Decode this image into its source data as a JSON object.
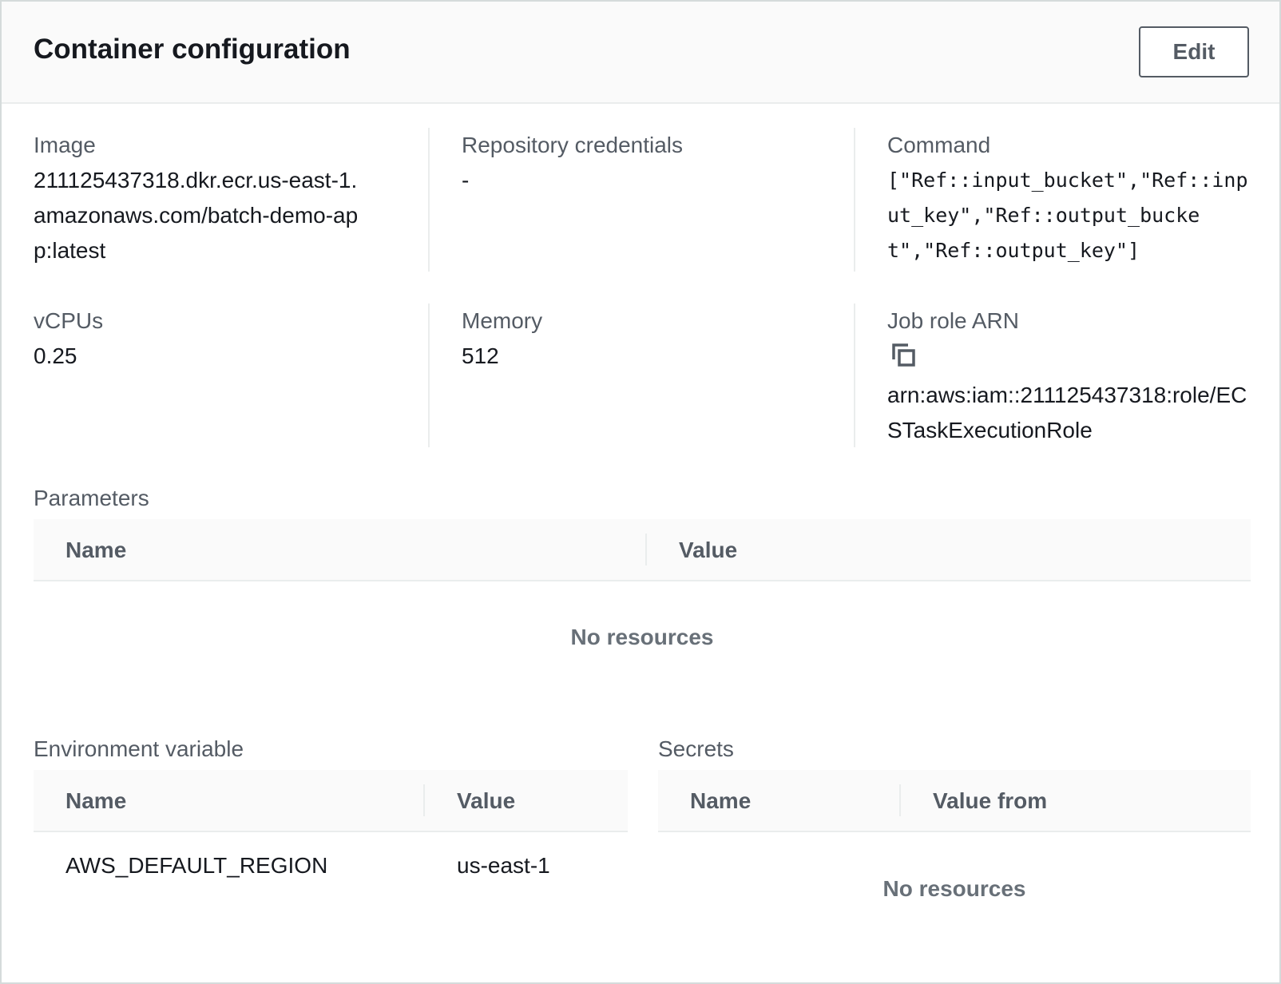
{
  "header": {
    "title": "Container configuration",
    "edit_label": "Edit"
  },
  "details": {
    "image": {
      "label": "Image",
      "value": "211125437318.dkr.ecr.us-east-1.amazonaws.com/batch-demo-app:latest"
    },
    "repo_credentials": {
      "label": "Repository credentials",
      "value": "-"
    },
    "command": {
      "label": "Command",
      "value": "[\"Ref::input_bucket\",\"Ref::input_key\",\"Ref::output_bucket\",\"Ref::output_key\"]"
    },
    "vcpus": {
      "label": "vCPUs",
      "value": "0.25"
    },
    "memory": {
      "label": "Memory",
      "value": "512"
    },
    "job_role_arn": {
      "label": "Job role ARN",
      "value": "arn:aws:iam::211125437318:role/ECSTaskExecutionRole",
      "icon": "copy-icon"
    }
  },
  "parameters": {
    "label": "Parameters",
    "columns": [
      "Name",
      "Value"
    ],
    "empty_text": "No resources"
  },
  "environment": {
    "label": "Environment variable",
    "columns": [
      "Name",
      "Value"
    ],
    "rows": [
      {
        "name": "AWS_DEFAULT_REGION",
        "value": "us-east-1"
      }
    ]
  },
  "secrets": {
    "label": "Secrets",
    "columns": [
      "Name",
      "Value from"
    ],
    "empty_text": "No resources"
  }
}
